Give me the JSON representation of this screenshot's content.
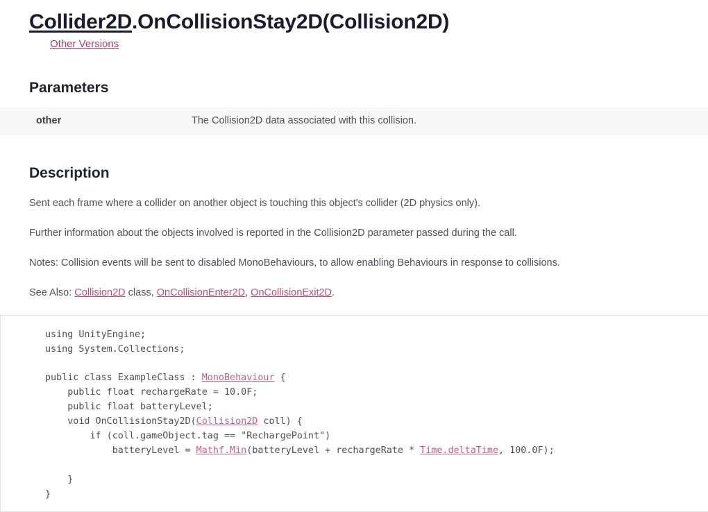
{
  "header": {
    "signature_class": "Collider2D",
    "signature_rest": ".OnCollisionStay2D(Collision2D)",
    "other_versions_label": "Other Versions"
  },
  "parameters": {
    "section_title": "Parameters",
    "rows": [
      {
        "name": "other",
        "description": "The Collision2D data associated with this collision."
      }
    ]
  },
  "description": {
    "section_title": "Description",
    "paragraphs": [
      "Sent each frame where a collider on another object is touching this object's collider (2D physics only).",
      "Further information about the objects involved is reported in the Collision2D parameter passed during the call.",
      "Notes: Collision events will be sent to disabled MonoBehaviours, to allow enabling Behaviours in response to collisions."
    ],
    "see_also": {
      "prefix": "See Also: ",
      "link1": "Collision2D",
      "mid1": " class, ",
      "link2": "OnCollisionEnter2D",
      "mid2": ", ",
      "link3": "OnCollisionExit2D",
      "suffix": "."
    }
  },
  "code_sample": {
    "line1": "using UnityEngine;",
    "line2": "using System.Collections;",
    "line3_a": "public class ExampleClass : ",
    "line3_link": "MonoBehaviour",
    "line3_b": " {",
    "line4": "    public float rechargeRate = 10.0F;",
    "line5": "    public float batteryLevel;",
    "line6_a": "    void OnCollisionStay2D(",
    "line6_link": "Collision2D",
    "line6_b": " coll) {",
    "line7": "        if (coll.gameObject.tag == \"RechargePoint\")",
    "line8_a": "            batteryLevel = ",
    "line8_link1": "Mathf.Min",
    "line8_b": "(batteryLevel + rechargeRate * ",
    "line8_link2": "Time.deltaTime",
    "line8_c": ", 100.0F);",
    "line9": "",
    "line10": "    }",
    "line11": "}"
  },
  "colors": {
    "link": "#b85070",
    "code_link": "#c06080",
    "heading": "#1f252b",
    "body_text": "#4b5157",
    "param_row_bg": "#f7f7f8",
    "code_border": "#e2e2e4"
  }
}
